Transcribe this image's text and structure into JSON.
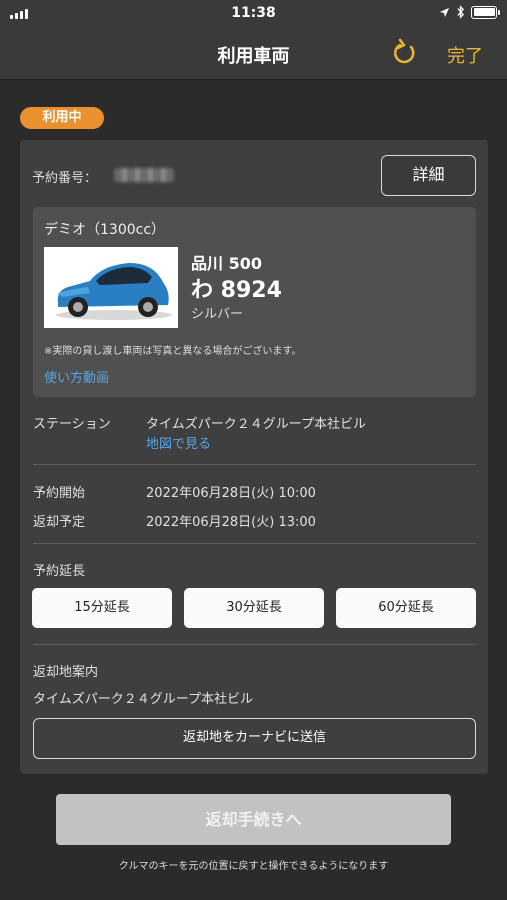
{
  "status_bar": {
    "time": "11:38"
  },
  "nav": {
    "title": "利用車両",
    "done_label": "完了"
  },
  "badge": "利用中",
  "reservation": {
    "number_label": "予約番号：",
    "detail_button": "詳細"
  },
  "car": {
    "name": "デミオ（1300cc）",
    "plate_line1": "品川 500",
    "plate_line2": "わ 8924",
    "color": "シルバー",
    "note": "※実際の貸し渡し車両は写真と異なる場合がございます。",
    "howto_link": "使い方動画"
  },
  "station": {
    "label": "ステーション",
    "name": "タイムズパーク２４グループ本社ビル",
    "map_link": "地図で見る"
  },
  "schedule": {
    "start_label": "予約開始",
    "start_value": "2022年06月28日(火) 10:00",
    "return_label": "返却予定",
    "return_value": "2022年06月28日(火) 13:00"
  },
  "extension": {
    "label": "予約延長",
    "buttons": [
      "15分延長",
      "30分延長",
      "60分延長"
    ]
  },
  "return_place": {
    "label": "返却地案内",
    "name": "タイムズパーク２４グループ本社ビル",
    "navi_button": "返却地をカーナビに送信"
  },
  "return_button": "返却手続きへ",
  "footnote": "クルマのキーを元の位置に戻すと操作できるようになります",
  "colors": {
    "accent": "#e9b633",
    "badge": "#e8912e",
    "link": "#58a6e6",
    "background": "#2b2b2b"
  }
}
